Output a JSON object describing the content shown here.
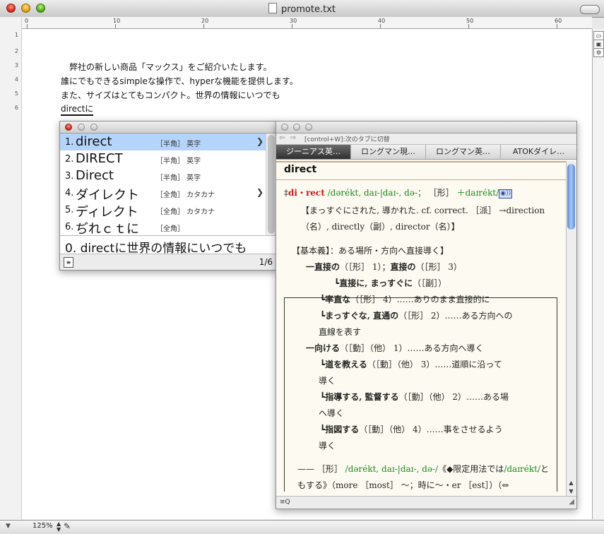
{
  "window": {
    "title": "promote.txt"
  },
  "ruler": {
    "marks": [
      "0",
      "10",
      "20",
      "30",
      "40",
      "50",
      "60"
    ]
  },
  "gutter": {
    "line_numbers": [
      "1",
      "2",
      "3",
      "4",
      "5",
      "6"
    ]
  },
  "document": {
    "lines": [
      "　弊社の新しい商品「マックス」をご紹介いたします。",
      "誰にでもできるsimpleな操作で、hyperな機能を提供します。",
      "また、サイズはとてもコンパクト。世界の情報にいつでも"
    ],
    "inline_input": "directに"
  },
  "status": {
    "zoom": "125%"
  },
  "candidates": {
    "items": [
      {
        "num": "1.",
        "word": "direct",
        "tag": "［半角］ 英字",
        "has_sub": true
      },
      {
        "num": "2.",
        "word": "DIRECT",
        "tag": "［半角］ 英字",
        "has_sub": false
      },
      {
        "num": "3.",
        "word": "Direct",
        "tag": "［半角］ 英字",
        "has_sub": false
      },
      {
        "num": "4.",
        "word": "ダイレクト",
        "tag": "［全角］ カタカナ",
        "has_sub": true
      },
      {
        "num": "5.",
        "word": "ディレクト",
        "tag": "［全角］ カタカナ",
        "has_sub": false
      },
      {
        "num": "6.",
        "word": "ぢれｃｔに",
        "tag": "［全角］",
        "has_sub": false
      }
    ],
    "alt": "0. directに世界の情報にいつでも",
    "count": "1/6"
  },
  "dictionary": {
    "hint": "[control+W]:次のタブに切替",
    "tabs": [
      "ジーニアス英…",
      "ロングマン現…",
      "ロングマン英…",
      "ATOKダイレ…"
    ],
    "headword": "direct",
    "entry": {
      "mark": "‡",
      "head": "di・rect",
      "pron": "/dərékt, daɪ-|daɪ-, də-；",
      "pos": "［形］",
      "variant": "＋daɪrékt/",
      "speaker": "◉))",
      "etym1": "【まっすぐにされた, 導かれた. cf. correct. ［派］ →direction",
      "etym2": "（名）, directly（副）, director（名）】"
    },
    "box": [
      {
        "t": "【基本義】：ある場所・方向へ直接導く】"
      },
      {
        "b": "一直接の",
        "t": "（［形］ 1）；",
        "b2": "直接の",
        "t2": "（［形］ 3）"
      },
      {
        "b": "┗直接に, まっすぐに",
        "t": "（［副］）"
      },
      {
        "b": "┗率直な",
        "t": "（［形］ 4）……ありのまま直接的に"
      },
      {
        "b": "┗まっすぐな, 直通の",
        "t": "（［形］ 2）……ある方向への"
      },
      {
        "t": "直線を表す"
      },
      {
        "b": "一向ける",
        "t": "（［動］（他） 1）……ある方向へ導く"
      },
      {
        "b": "┗道を教える",
        "t": "（［動］（他） 3）……道順に沿って"
      },
      {
        "t": "導く"
      },
      {
        "b": "┗指導する, 監督する",
        "t": "（［動］（他） 2）……ある場"
      },
      {
        "t": "へ導く"
      },
      {
        "b": "┗指図する",
        "t": "（［動］（他） 4）……事をさせるよう"
      },
      {
        "t": "導く"
      }
    ],
    "tail": {
      "dash": "——",
      "pos": "［形］",
      "pron": "/dərékt, daɪ-|daɪ-, də-/",
      "pre": "《◆限定用法では",
      "var": "/daɪrékt/",
      "post": "と",
      "line2": "もする》（more ［most］ 〜；時に〜・er ［est］）（⇔"
    },
    "foot_icon": "≡Q"
  }
}
